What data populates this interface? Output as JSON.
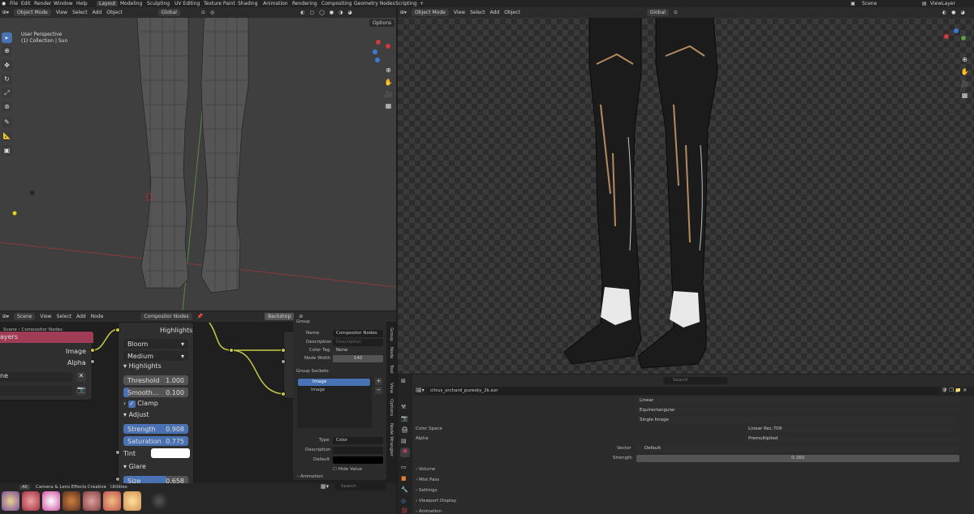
{
  "topbar": {
    "menu": [
      "File",
      "Edit",
      "Render",
      "Window",
      "Help"
    ],
    "workspaces": [
      "Layout",
      "Modeling",
      "Sculpting",
      "UV Editing",
      "Texture Paint",
      "Shading",
      "Animation",
      "Rendering",
      "Compositing",
      "Geometry Nodes",
      "Scripting"
    ],
    "active_workspace": "Layout",
    "plus": "+",
    "scene": "Scene",
    "view_layer": "ViewLayer"
  },
  "viewport_left": {
    "mode": "Object Mode",
    "menus": [
      "View",
      "Select",
      "Add",
      "Object"
    ],
    "orientation": "Global",
    "overlay_title": "User Perspective",
    "overlay_sub": "(1) Collection | Sun",
    "options": "Options"
  },
  "viewport_right": {
    "mode": "Object Mode",
    "menus": [
      "View",
      "Select",
      "Add",
      "Object"
    ],
    "orientation": "Global"
  },
  "compositor": {
    "header": {
      "scene": "Scene",
      "menus": [
        "View",
        "Select",
        "Add",
        "Node"
      ],
      "tree": "Compositor Nodes",
      "backdrop": "Backdrop"
    },
    "breadcrumb": {
      "scene": "Scene",
      "tree": "Compositor Nodes"
    },
    "rl_node": {
      "title": "ayers",
      "out_image": "Image",
      "out_alpha": "Alpha",
      "field": "ne",
      "close": "✕"
    },
    "glare_node": {
      "highlights_top": "Highlights",
      "type": "Bloom",
      "quality": "Medium",
      "sec_highlights": "Highlights",
      "threshold_label": "Threshold",
      "threshold_value": "1.000",
      "smooth_label": "Smooth...",
      "smooth_value": "0.100",
      "clamp": "Clamp",
      "sec_adjust": "Adjust",
      "strength_label": "Strength",
      "strength_value": "0.908",
      "saturation_label": "Saturation",
      "saturation_value": "0.775",
      "tint": "Tint",
      "sec_glare": "Glare",
      "size_label": "Size",
      "size_value": "0.658"
    },
    "n_panel": {
      "group_header": "Group",
      "name_label": "Name",
      "name_value": "Compositor Nodes",
      "desc_label": "Description",
      "desc_placeholder": "Description",
      "color_tag_label": "Color Tag",
      "color_tag_value": "None",
      "node_width_label": "Node Width",
      "node_width_value": "140",
      "sockets_header": "Group Sockets",
      "socket_input": "Image",
      "socket_output": "Image",
      "type_label": "Type",
      "type_value": "Color",
      "description_label": "Description",
      "default_label": "Default",
      "hide_value": "Hide Value",
      "animation": "Animation"
    },
    "side_tabs": [
      "Group",
      "Node",
      "Tool",
      "View",
      "Options",
      "Node Wrangler"
    ]
  },
  "asset_bar": {
    "filter_all": "All",
    "filter_items": [
      "Camera & Lens Effects",
      "Creative",
      "Utilities"
    ],
    "search_placeholder": "Search"
  },
  "world_props": {
    "search_placeholder": "Search",
    "image_name": "citrus_orchard_puresky_2k.exr",
    "interp": "Linear",
    "projection": "Equirectangular",
    "source": "Single Image",
    "color_space_label": "Color Space",
    "color_space_value": "Linear Rec.709",
    "alpha_label": "Alpha",
    "alpha_value": "Premultiplied",
    "vector_label": "Vector",
    "vector_value": "Default",
    "strength_label": "Strength",
    "strength_value": "0.160",
    "sections": [
      "Volume",
      "Mist Pass",
      "Settings",
      "Viewport Display",
      "Animation"
    ]
  },
  "gizmo": {
    "x": "X",
    "y": "Y",
    "z": "Z"
  },
  "colors": {
    "accent": "#4772b3",
    "socket_yellow": "#c8c845",
    "rl_header": "#a03c55"
  }
}
